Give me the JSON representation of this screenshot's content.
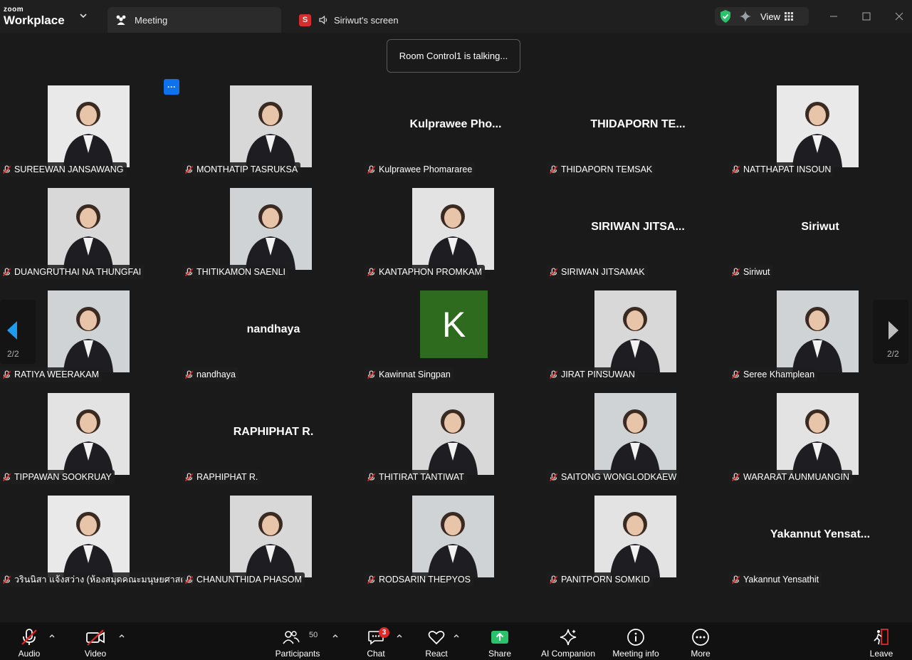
{
  "titlebar": {
    "brand_small": "zoom",
    "brand_large": "Workplace",
    "tab_meeting": "Meeting",
    "tab_screen_badge": "S",
    "tab_screen": "Siriwut's screen",
    "view_label": "View"
  },
  "toast": "Room Control1 is talking...",
  "more_label": "···",
  "pager": {
    "left": "2/2",
    "right": "2/2"
  },
  "participants": [
    {
      "name": "SUREEWAN JANSAWANG",
      "display": "",
      "photo": true
    },
    {
      "name": "MONTHATIP TASRUKSA",
      "display": "",
      "photo": true
    },
    {
      "name": "Kulprawee Phomararee",
      "display": "Kulprawee  Pho...",
      "photo": false
    },
    {
      "name": "THIDAPORN TEMSAK",
      "display": "THIDAPORN  TE...",
      "photo": false
    },
    {
      "name": "NATTHAPAT INSOUN",
      "display": "",
      "photo": true
    },
    {
      "name": "DUANGRUTHAI NA THUNGFAI",
      "display": "",
      "photo": true
    },
    {
      "name": "THITIKAMON SAENLI",
      "display": "",
      "photo": true
    },
    {
      "name": "KANTAPHON PROMKAM",
      "display": "",
      "photo": true
    },
    {
      "name": "SIRIWAN JITSAMAK",
      "display": "SIRIWAN  JITSA...",
      "photo": false
    },
    {
      "name": "Siriwut",
      "display": "Siriwut",
      "photo": false
    },
    {
      "name": "RATIYA WEERAKAM",
      "display": "",
      "photo": true
    },
    {
      "name": "nandhaya",
      "display": "nandhaya",
      "photo": false
    },
    {
      "name": "Kawinnat Singpan",
      "display": "",
      "photo": false,
      "initial": "K"
    },
    {
      "name": "JIRAT PINSUWAN",
      "display": "",
      "photo": true
    },
    {
      "name": "Seree Khamplean",
      "display": "",
      "photo": true
    },
    {
      "name": "TIPPAWAN SOOKRUAY",
      "display": "",
      "photo": true
    },
    {
      "name": "RAPHIPHAT R.",
      "display": "RAPHIPHAT R.",
      "photo": false
    },
    {
      "name": "THITIRAT TANTIWAT",
      "display": "",
      "photo": true
    },
    {
      "name": "SAITONG WONGLODKAEW",
      "display": "",
      "photo": true
    },
    {
      "name": "WARARAT AUNMUANGIN",
      "display": "",
      "photo": true
    },
    {
      "name": "วรินนิสา แจ้งสว่าง (ห้องสมุดคณะมนุษยศาสตร์)",
      "display": "",
      "photo": true
    },
    {
      "name": "CHANUNTHIDA PHASOM",
      "display": "",
      "photo": true
    },
    {
      "name": "RODSARIN THEPYOS",
      "display": "",
      "photo": true
    },
    {
      "name": "PANITPORN SOMKID",
      "display": "",
      "photo": true
    },
    {
      "name": "Yakannut Yensathit",
      "display": "Yakannut  Yensat...",
      "photo": false
    }
  ],
  "toolbar": {
    "audio": "Audio",
    "video": "Video",
    "participants": "Participants",
    "participants_count": "50",
    "chat": "Chat",
    "chat_badge": "3",
    "react": "React",
    "share": "Share",
    "ai": "AI Companion",
    "info": "Meeting info",
    "more": "More",
    "leave": "Leave"
  },
  "colors": {
    "accent_blue": "#0e72ed",
    "share_green": "#2bc26b",
    "mute_red": "#e02828",
    "avatar_green": "#2e6b1e"
  }
}
